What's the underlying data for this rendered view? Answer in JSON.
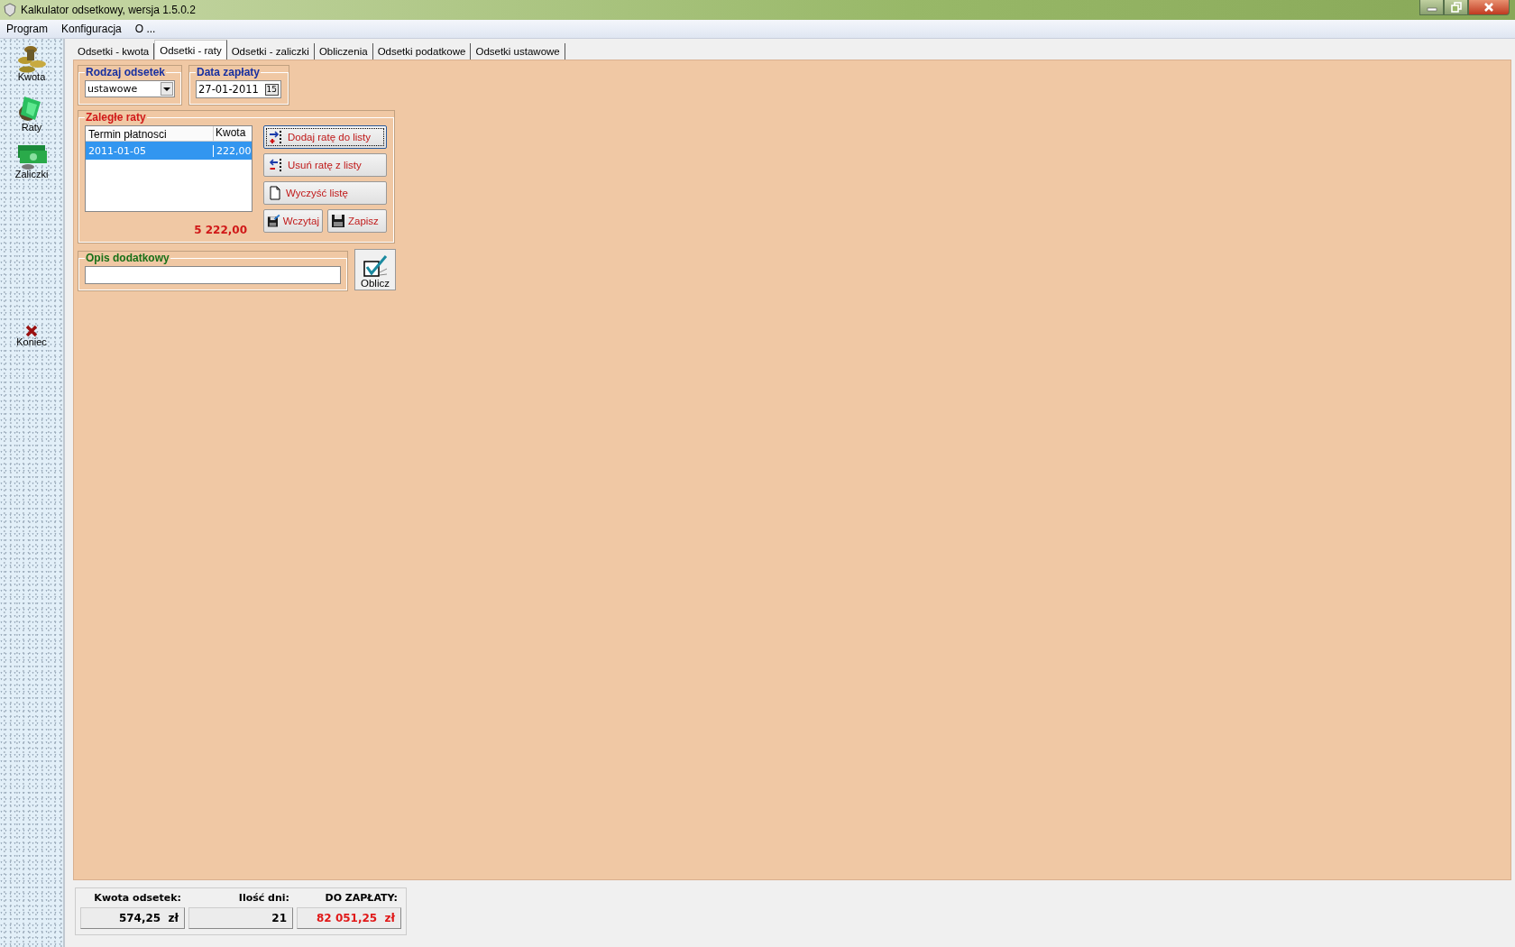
{
  "window": {
    "title": "Kalkulator odsetkowy, wersja 1.5.0.2"
  },
  "menu": [
    "Program",
    "Konfiguracja",
    "O ..."
  ],
  "sidebar": {
    "items": [
      {
        "label": "Kwota",
        "kind": "coins"
      },
      {
        "label": "Raty",
        "kind": "money"
      },
      {
        "label": "Zaliczki",
        "kind": "bills"
      },
      {
        "label": "Koniec",
        "kind": "exit"
      }
    ]
  },
  "tabs": [
    {
      "label": "Odsetki - kwota",
      "selected": false
    },
    {
      "label": "Odsetki - raty",
      "selected": true
    },
    {
      "label": "Odsetki - zaliczki",
      "selected": false
    },
    {
      "label": "Obliczenia",
      "selected": false
    },
    {
      "label": "Odsetki podatkowe",
      "selected": false
    },
    {
      "label": "Odsetki ustawowe",
      "selected": false
    }
  ],
  "rodzaj_odsetek": {
    "title": "Rodzaj odsetek",
    "value": "ustawowe"
  },
  "data_zaplaty": {
    "title": "Data zapłaty",
    "value": "27-01-2011",
    "calendar_day": "15"
  },
  "zalegle_raty": {
    "title": "Zaległe raty",
    "columns": [
      "Termin płatnosci",
      "Kwota"
    ],
    "rows": [
      {
        "cells": [
          "2011-01-05",
          "222,00"
        ],
        "selected": true
      }
    ],
    "total": "5 222,00",
    "buttons": [
      {
        "label": "Dodaj ratę do listy",
        "kind": "add",
        "focused": true
      },
      {
        "label": "Usuń ratę z listy",
        "kind": "remove",
        "focused": false
      },
      {
        "label": "Wyczyść listę",
        "kind": "clear",
        "focused": false
      },
      {
        "label": "Wczytaj",
        "kind": "load",
        "focused": false
      },
      {
        "label": "Zapisz",
        "kind": "save",
        "focused": false
      }
    ]
  },
  "opis_dodatkowy": {
    "title": "Opis dodatkowy"
  },
  "oblicz_button": {
    "label": "Oblicz"
  },
  "summary": [
    {
      "label": "Kwota odsetek:",
      "value": "574,25  zł",
      "highlight": false
    },
    {
      "label": "Ilość dni:",
      "value": "21",
      "highlight": false
    },
    {
      "label": "DO ZAPŁATY:",
      "value": "82 051,25  zł",
      "highlight": true
    }
  ]
}
